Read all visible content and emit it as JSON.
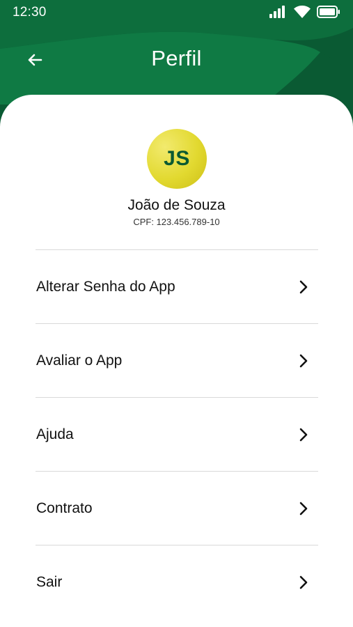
{
  "status_bar": {
    "time": "12:30",
    "icons": [
      "signal-icon",
      "wifi-icon",
      "battery-icon"
    ]
  },
  "header": {
    "title": "Perfil",
    "back_icon": "arrow-left-icon",
    "background_color": "#0a5d34",
    "accent_color": "#0e7a43"
  },
  "profile": {
    "initials": "JS",
    "name": "João de Souza",
    "cpf": "CPF: 123.456.789-10",
    "avatar_color": "#e2d930",
    "initials_color": "#0b5a32"
  },
  "menu": {
    "items": [
      {
        "label": "Alterar Senha do App",
        "icon": "chevron-right-icon"
      },
      {
        "label": "Avaliar o App",
        "icon": "chevron-right-icon"
      },
      {
        "label": "Ajuda",
        "icon": "chevron-right-icon"
      },
      {
        "label": "Contrato",
        "icon": "chevron-right-icon"
      },
      {
        "label": "Sair",
        "icon": "chevron-right-icon"
      }
    ]
  }
}
